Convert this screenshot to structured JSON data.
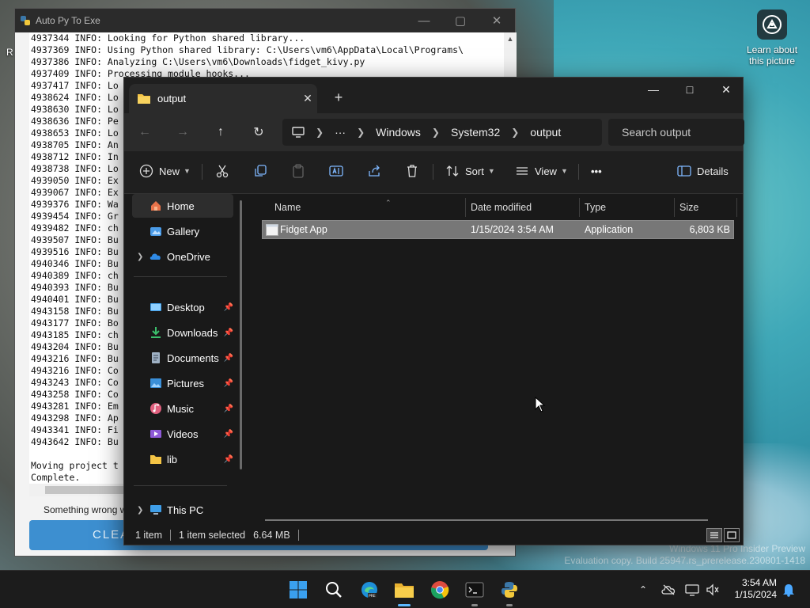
{
  "desktop": {
    "learn_widget": "Learn about this picture",
    "edge_fragment": "R",
    "watermark_line1": "Windows 11 Pro Insider Preview",
    "watermark_line2": "Evaluation copy. Build 25947.rs_prerelease.230801-1418"
  },
  "autopy": {
    "title": "Auto Py To Exe",
    "console_lines": [
      "4937344 INFO: Looking for Python shared library...",
      "4937369 INFO: Using Python shared library: C:\\Users\\vm6\\AppData\\Local\\Programs\\",
      "4937386 INFO: Analyzing C:\\Users\\vm6\\Downloads\\fidget_kivy.py",
      "4937409 INFO: Processing module hooks...",
      "4937417 INFO: Lo",
      "4938624 INFO: Lo",
      "4938630 INFO: Lo",
      "4938636 INFO: Pe",
      "4938653 INFO: Lo",
      "4938705 INFO: An",
      "4938712 INFO: In",
      "4938738 INFO: Lo",
      "4939050 INFO: Ex",
      "4939067 INFO: Ex",
      "4939376 INFO: Wa",
      "4939454 INFO: Gr",
      "4939482 INFO: ch",
      "4939507 INFO: Bu",
      "4939516 INFO: Bu",
      "4940346 INFO: Bu",
      "4940389 INFO: ch",
      "4940393 INFO: Bu",
      "4940401 INFO: Bu",
      "4943158 INFO: Bu",
      "4943177 INFO: Bo",
      "4943185 INFO: ch",
      "4943204 INFO: Bu",
      "4943216 INFO: Bu",
      "4943216 INFO: Co",
      "4943243 INFO: Co",
      "4943258 INFO: Co",
      "4943281 INFO: Em",
      "4943298 INFO: Ap",
      "4943341 INFO: Fi",
      "4943642 INFO: Bu",
      "",
      "Moving project t",
      "Complete."
    ],
    "something_wrong": "Something wrong w",
    "clear_button": "CLEA"
  },
  "explorer": {
    "tab_label": "output",
    "breadcrumb": [
      "Windows",
      "System32",
      "output"
    ],
    "search_placeholder": "Search output",
    "toolbar": {
      "new_label": "New",
      "sort_label": "Sort",
      "view_label": "View",
      "more_label": "•••",
      "details_label": "Details"
    },
    "nav": {
      "home": "Home",
      "gallery": "Gallery",
      "onedrive": "OneDrive",
      "desktop": "Desktop",
      "downloads": "Downloads",
      "documents": "Documents",
      "pictures": "Pictures",
      "music": "Music",
      "videos": "Videos",
      "lib": "lib",
      "thispc": "This PC"
    },
    "columns": {
      "name": "Name",
      "date": "Date modified",
      "type": "Type",
      "size": "Size"
    },
    "files": [
      {
        "name": "Fidget App",
        "date": "1/15/2024 3:54 AM",
        "type": "Application",
        "size": "6,803 KB"
      }
    ],
    "status": {
      "count": "1 item",
      "selected": "1 item selected",
      "selected_size": "6.64 MB"
    }
  },
  "taskbar": {
    "time": "3:54 AM",
    "date": "1/15/2024"
  }
}
